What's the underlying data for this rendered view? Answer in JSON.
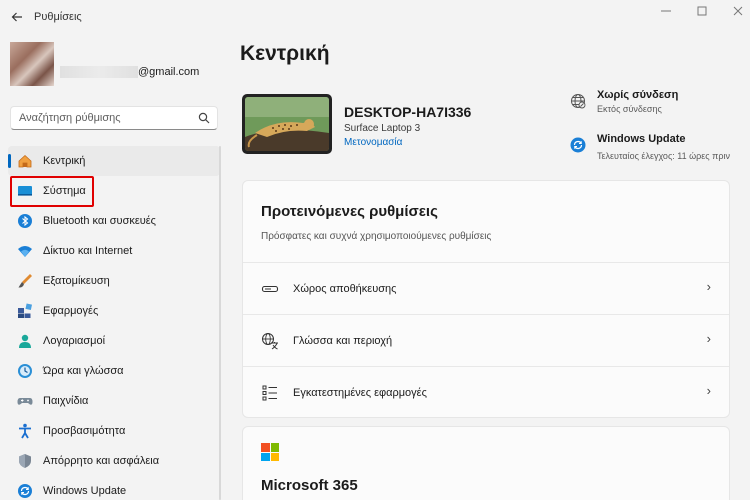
{
  "window": {
    "title": "Ρυθμίσεις"
  },
  "account": {
    "email": "@gmail.com"
  },
  "search": {
    "placeholder": "Αναζήτηση ρύθμισης"
  },
  "sidebar": {
    "items": [
      {
        "label": "Κεντρική",
        "icon": "home-icon",
        "active": true
      },
      {
        "label": "Σύστημα",
        "icon": "system-icon"
      },
      {
        "label": "Bluetooth και συσκευές",
        "icon": "bluetooth-icon"
      },
      {
        "label": "Δίκτυο και Internet",
        "icon": "wifi-icon"
      },
      {
        "label": "Εξατομίκευση",
        "icon": "brush-icon"
      },
      {
        "label": "Εφαρμογές",
        "icon": "apps-icon"
      },
      {
        "label": "Λογαριασμοί",
        "icon": "person-icon"
      },
      {
        "label": "Ώρα και γλώσσα",
        "icon": "clock-icon"
      },
      {
        "label": "Παιχνίδια",
        "icon": "gamepad-icon"
      },
      {
        "label": "Προσβασιμότητα",
        "icon": "accessibility-icon"
      },
      {
        "label": "Απόρρητο και ασφάλεια",
        "icon": "shield-icon"
      },
      {
        "label": "Windows Update",
        "icon": "update-icon"
      }
    ]
  },
  "main": {
    "title": "Κεντρική",
    "device": {
      "name": "DESKTOP-HA7I336",
      "model": "Surface Laptop 3",
      "rename": "Μετονομασία"
    },
    "status": {
      "network": {
        "title": "Χωρίς σύνδεση",
        "subtitle": "Εκτός σύνδεσης"
      },
      "update": {
        "title": "Windows Update",
        "subtitle": "Τελευταίος έλεγχος: 11 ώρες πριν"
      }
    },
    "recommended": {
      "title": "Προτεινόμενες ρυθμίσεις",
      "subtitle": "Πρόσφατες και συχνά χρησιμοποιούμενες ρυθμίσεις",
      "rows": [
        {
          "label": "Χώρος αποθήκευσης",
          "icon": "storage-icon"
        },
        {
          "label": "Γλώσσα και περιοχή",
          "icon": "language-icon"
        },
        {
          "label": "Εγκατεστημένες εφαρμογές",
          "icon": "installed-apps-icon"
        }
      ]
    },
    "m365": {
      "title": "Microsoft 365"
    }
  },
  "colors": {
    "accent": "#0067c0",
    "highlight": "#e00000"
  }
}
